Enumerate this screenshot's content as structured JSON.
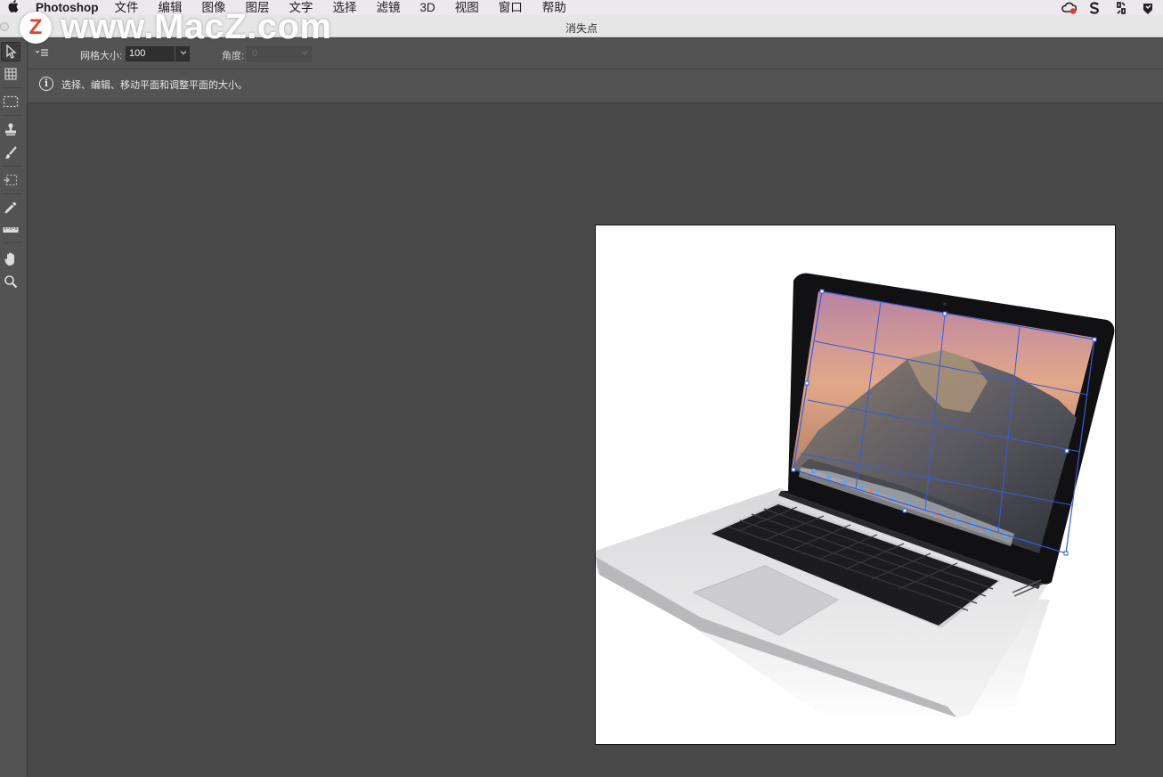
{
  "menubar": {
    "app_name": "Photoshop",
    "items": [
      "文件",
      "编辑",
      "图像",
      "图层",
      "文字",
      "选择",
      "滤镜",
      "3D",
      "视图",
      "窗口",
      "帮助"
    ]
  },
  "watermark": {
    "logo_letter": "Z",
    "text": "www.MacZ.com"
  },
  "window": {
    "title": "消失点"
  },
  "options": {
    "grid_size_label": "网格大小:",
    "grid_size_value": "100",
    "angle_label": "角度:",
    "angle_value": "0"
  },
  "info": {
    "text": "选择、编辑、移动平面和调整平面的大小。"
  },
  "tools": [
    {
      "name": "edit-plane-tool",
      "icon": "arrow-cursor-icon",
      "active": true
    },
    {
      "name": "create-plane-tool",
      "icon": "grid-plane-icon"
    },
    {
      "name": "marquee-tool",
      "icon": "dashed-rectangle-icon"
    },
    {
      "name": "stamp-tool",
      "icon": "stamp-icon"
    },
    {
      "name": "brush-tool",
      "icon": "brush-icon"
    },
    {
      "name": "transform-tool",
      "icon": "transform-icon"
    },
    {
      "name": "eyedropper-tool",
      "icon": "eyedropper-icon"
    },
    {
      "name": "measure-tool",
      "icon": "ruler-icon"
    },
    {
      "name": "hand-tool",
      "icon": "hand-icon"
    },
    {
      "name": "zoom-tool",
      "icon": "magnifier-icon"
    }
  ],
  "colors": {
    "canvas_bg": "#484848",
    "panel_bg": "#535353",
    "plane_grid": "#3a5bd9",
    "watermark_logo": "#e8402d"
  }
}
